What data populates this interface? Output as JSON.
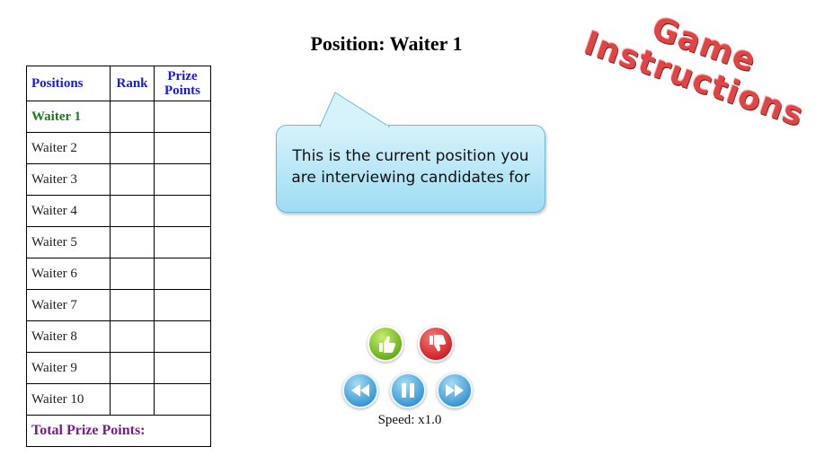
{
  "title": "Position: Waiter 1",
  "table": {
    "headers": {
      "positions": "Positions",
      "rank": "Rank",
      "prize_line1": "Prize",
      "prize_line2": "Points"
    },
    "rows": [
      {
        "position": "Waiter 1",
        "rank": "",
        "prize": "",
        "current": true
      },
      {
        "position": "Waiter 2",
        "rank": "",
        "prize": ""
      },
      {
        "position": "Waiter 3",
        "rank": "",
        "prize": ""
      },
      {
        "position": "Waiter 4",
        "rank": "",
        "prize": ""
      },
      {
        "position": "Waiter 5",
        "rank": "",
        "prize": ""
      },
      {
        "position": "Waiter 6",
        "rank": "",
        "prize": ""
      },
      {
        "position": "Waiter 7",
        "rank": "",
        "prize": ""
      },
      {
        "position": "Waiter 8",
        "rank": "",
        "prize": ""
      },
      {
        "position": "Waiter 9",
        "rank": "",
        "prize": ""
      },
      {
        "position": "Waiter 10",
        "rank": "",
        "prize": ""
      }
    ],
    "total_label": "Total Prize Points:"
  },
  "bubble": {
    "line1": "This is the current position you",
    "line2": "are interviewing candidates for"
  },
  "game_instructions": {
    "line1": "Game",
    "line2": "Instructions"
  },
  "controls": {
    "like_icon": "thumbs-up-icon",
    "dislike_icon": "thumbs-down-icon",
    "rewind_icon": "rewind-icon",
    "pause_icon": "pause-icon",
    "forward_icon": "fast-forward-icon",
    "speed_label": "Speed: x1.0"
  },
  "colors": {
    "header_text": "#1a1ad8",
    "current_row_text": "#1a7a1a",
    "total_text": "#7a1a8a",
    "instructions_red": "#e04545",
    "bubble_blue": "#9edcf3",
    "like_green": "#6ab21e",
    "dislike_red": "#d3262a",
    "control_blue": "#3c9ad4"
  }
}
